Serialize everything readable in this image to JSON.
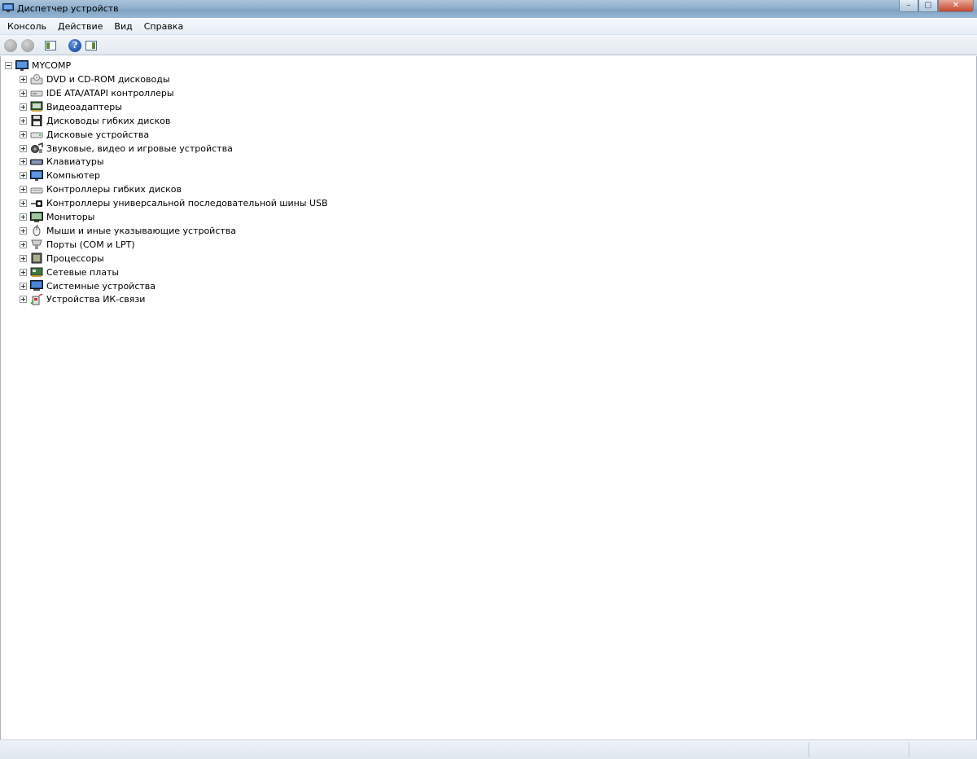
{
  "window": {
    "title": "Диспетчер устройств",
    "minimize_glyph": "–",
    "maximize_glyph": "▢",
    "close_glyph": "✕"
  },
  "menu": {
    "items": [
      "Консоль",
      "Действие",
      "Вид",
      "Справка"
    ]
  },
  "toolbar": {
    "help_glyph": "?",
    "icons": [
      "back-icon",
      "forward-icon",
      "show-hide-console-tree-icon",
      "help-icon",
      "show-hide-action-pane-icon"
    ]
  },
  "tree": {
    "root": {
      "label": "MYCOMP",
      "icon": "computer-icon",
      "expanded": true
    },
    "items": [
      {
        "label": "DVD и CD-ROM дисководы",
        "icon": "optical-drive-icon"
      },
      {
        "label": "IDE ATA/ATAPI контроллеры",
        "icon": "ide-controller-icon"
      },
      {
        "label": "Видеоадаптеры",
        "icon": "display-adapter-icon"
      },
      {
        "label": "Дисководы гибких дисков",
        "icon": "floppy-drive-icon"
      },
      {
        "label": "Дисковые устройства",
        "icon": "disk-drive-icon"
      },
      {
        "label": "Звуковые, видео и игровые устройства",
        "icon": "sound-device-icon"
      },
      {
        "label": "Клавиатуры",
        "icon": "keyboard-icon"
      },
      {
        "label": "Компьютер",
        "icon": "computer-icon"
      },
      {
        "label": "Контроллеры гибких дисков",
        "icon": "floppy-controller-icon"
      },
      {
        "label": "Контроллеры универсальной последовательной шины USB",
        "icon": "usb-controller-icon"
      },
      {
        "label": "Мониторы",
        "icon": "monitor-icon"
      },
      {
        "label": "Мыши и иные указывающие устройства",
        "icon": "mouse-icon"
      },
      {
        "label": "Порты (COM и LPT)",
        "icon": "port-icon"
      },
      {
        "label": "Процессоры",
        "icon": "processor-icon"
      },
      {
        "label": "Сетевые платы",
        "icon": "network-adapter-icon"
      },
      {
        "label": "Системные устройства",
        "icon": "system-device-icon"
      },
      {
        "label": "Устройства ИК-связи",
        "icon": "infrared-device-icon"
      }
    ]
  },
  "colors": {
    "titlebar": "#8fb0cd",
    "menubar": "#eef3f8",
    "content_bg": "#ffffff",
    "close_button": "#c4472f"
  }
}
